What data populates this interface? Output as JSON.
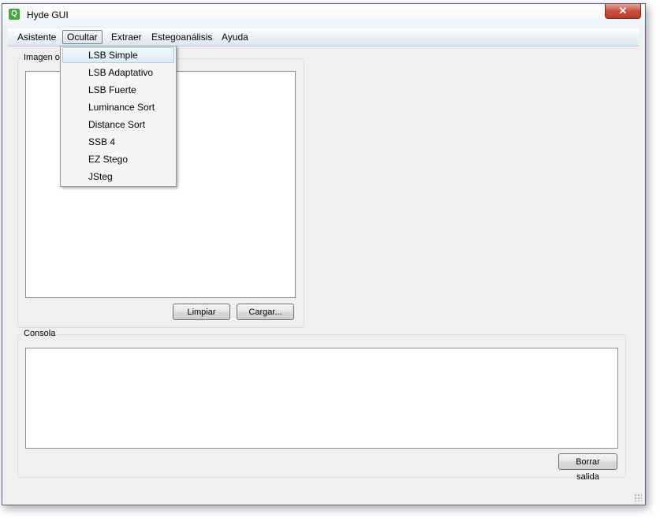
{
  "window": {
    "title": "Hyde GUI",
    "close_glyph": "✕"
  },
  "menubar": [
    {
      "label": "Asistente"
    },
    {
      "label": "Ocultar"
    },
    {
      "label": "Extraer"
    },
    {
      "label": "Estegoanálisis"
    },
    {
      "label": "Ayuda"
    }
  ],
  "dropdown": {
    "menu": "Ocultar",
    "items": [
      {
        "label": "LSB Simple"
      },
      {
        "label": "LSB Adaptativo"
      },
      {
        "label": "LSB Fuerte"
      },
      {
        "label": "Luminance Sort"
      },
      {
        "label": "Distance Sort"
      },
      {
        "label": "SSB 4"
      },
      {
        "label": "EZ Stego"
      },
      {
        "label": "JSteg"
      }
    ]
  },
  "image_group": {
    "title": "Imagen o",
    "clear_label": "Limpiar",
    "load_label": "Cargar..."
  },
  "console_group": {
    "title": "Consola",
    "output": "",
    "clear_output_label": "Borrar salida"
  },
  "icons": {
    "app": "qt-app-icon",
    "close": "close-icon",
    "resize": "resize-grip-icon"
  },
  "colors": {
    "highlight": "#dcebfb",
    "close": "#c7503d"
  }
}
